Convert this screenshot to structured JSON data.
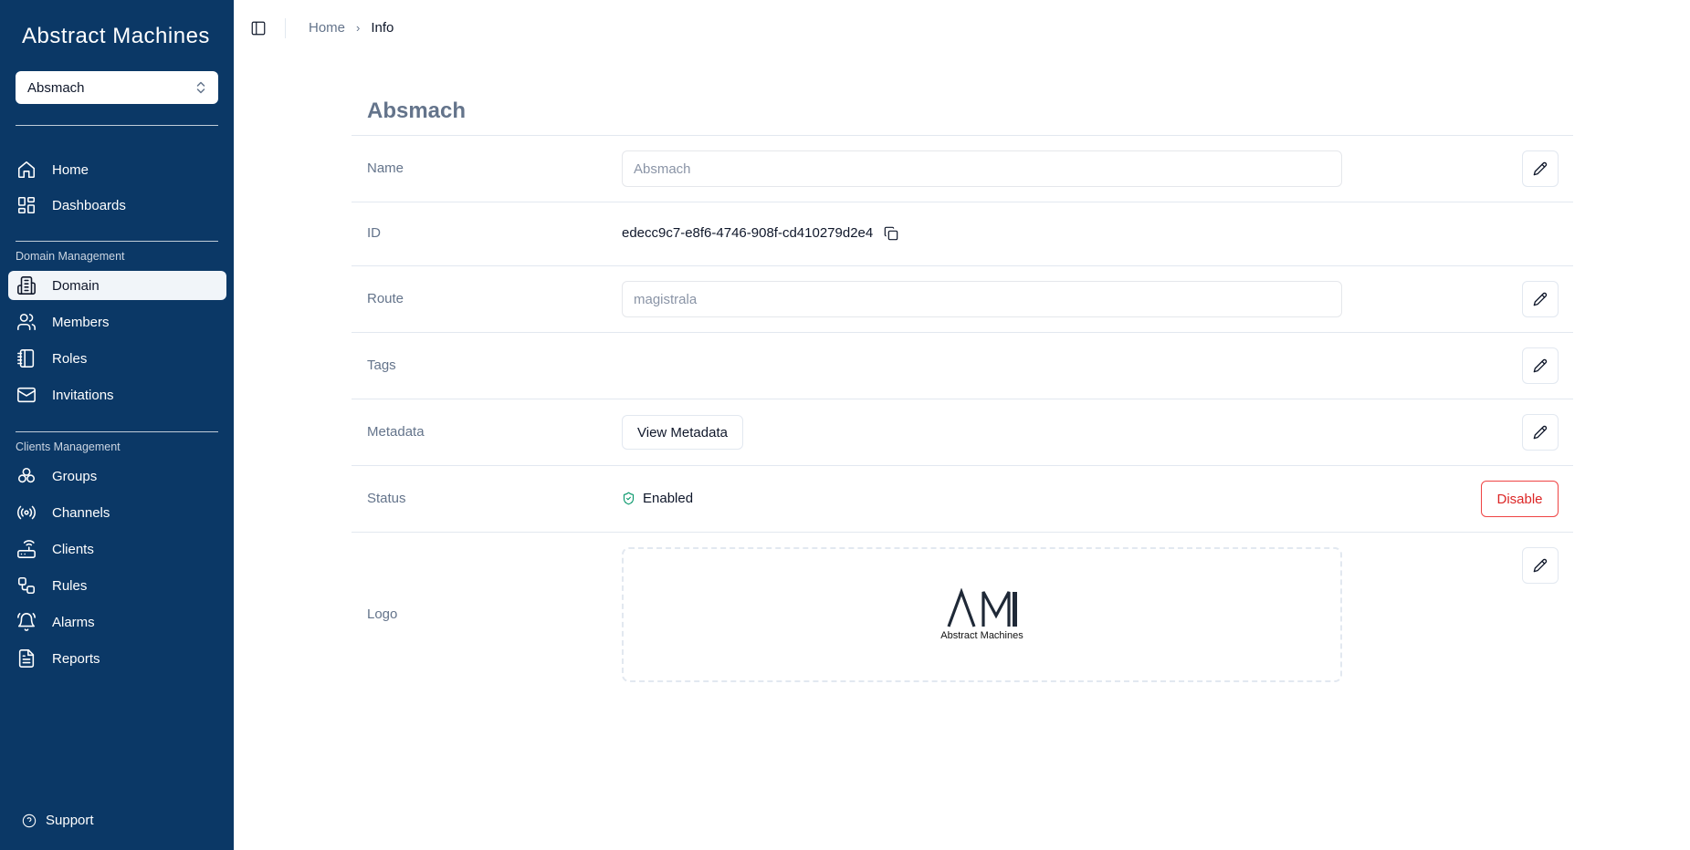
{
  "sidebar": {
    "brand": "Abstract Machines",
    "org_select": {
      "value": "Absmach"
    },
    "nav_top": [
      {
        "label": "Home",
        "icon": "home-icon"
      },
      {
        "label": "Dashboards",
        "icon": "dashboard-icon"
      }
    ],
    "section_domain": "Domain Management",
    "nav_domain": [
      {
        "label": "Domain",
        "icon": "building-icon",
        "active": true
      },
      {
        "label": "Members",
        "icon": "users-icon"
      },
      {
        "label": "Roles",
        "icon": "notebook-icon"
      },
      {
        "label": "Invitations",
        "icon": "mail-icon"
      }
    ],
    "section_clients": "Clients Management",
    "nav_clients": [
      {
        "label": "Groups",
        "icon": "groups-icon"
      },
      {
        "label": "Channels",
        "icon": "radio-icon"
      },
      {
        "label": "Clients",
        "icon": "router-icon"
      },
      {
        "label": "Rules",
        "icon": "workflow-icon"
      },
      {
        "label": "Alarms",
        "icon": "bell-icon"
      },
      {
        "label": "Reports",
        "icon": "file-text-icon"
      }
    ],
    "support": "Support"
  },
  "breadcrumb": {
    "home": "Home",
    "current": "Info"
  },
  "page": {
    "title": "Absmach",
    "rows": {
      "name": {
        "label": "Name",
        "value": "Absmach"
      },
      "id": {
        "label": "ID",
        "value": "edecc9c7-e8f6-4746-908f-cd410279d2e4"
      },
      "route": {
        "label": "Route",
        "value": "magistrala"
      },
      "tags": {
        "label": "Tags"
      },
      "metadata": {
        "label": "Metadata",
        "button": "View Metadata"
      },
      "status": {
        "label": "Status",
        "value": "Enabled",
        "action": "Disable"
      },
      "logo": {
        "label": "Logo",
        "mark": "AM",
        "caption": "Abstract Machines"
      }
    }
  },
  "colors": {
    "sidebar": "#0b3866",
    "status_ok": "#059669",
    "danger": "#dc2626"
  }
}
